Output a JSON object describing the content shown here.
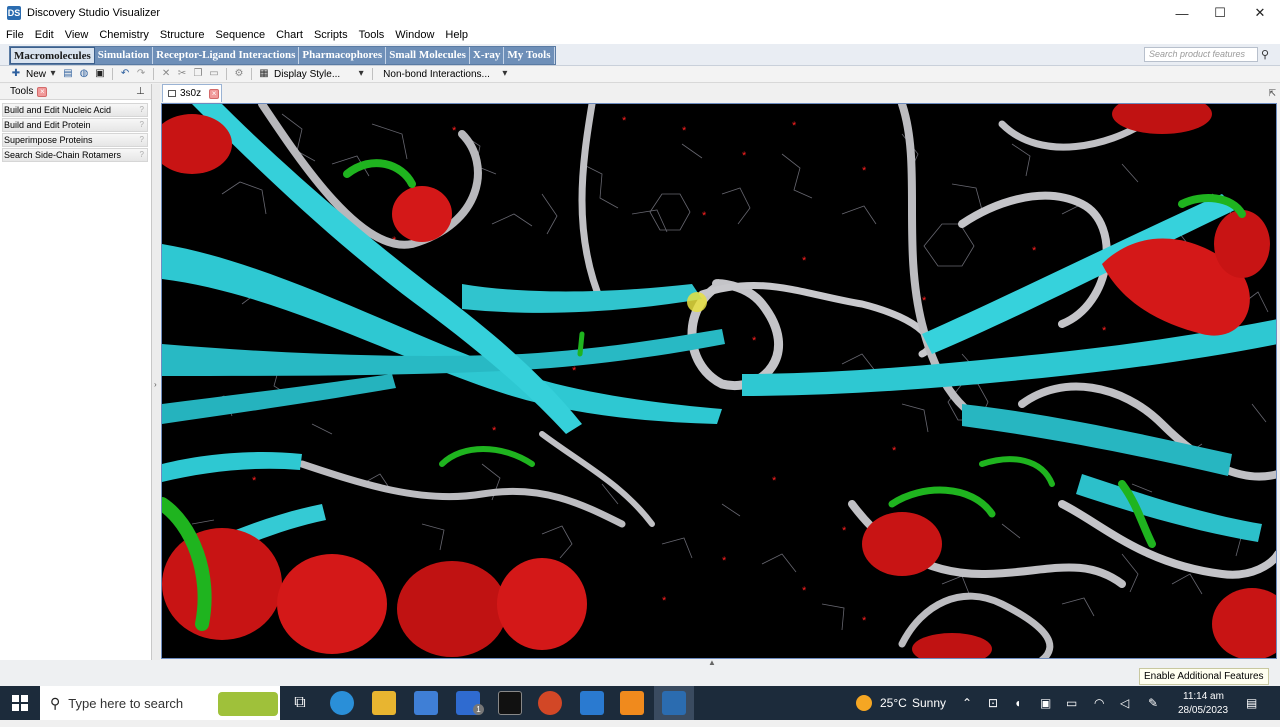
{
  "window": {
    "title": "Discovery Studio Visualizer",
    "minimize": "—",
    "maximize": "☐",
    "close": "✕"
  },
  "menu": [
    "File",
    "Edit",
    "View",
    "Chemistry",
    "Structure",
    "Sequence",
    "Chart",
    "Scripts",
    "Tools",
    "Window",
    "Help"
  ],
  "ribbon": {
    "tabs": [
      "Macromolecules",
      "Simulation",
      "Receptor-Ligand Interactions",
      "Pharmacophores",
      "Small Molecules",
      "X-ray",
      "My Tools"
    ],
    "active_tab": "Macromolecules",
    "search_placeholder": "Search product features"
  },
  "toolbar": {
    "new_label": "New",
    "display_style_label": "Display Style...",
    "nonbond_label": "Non-bond Interactions..."
  },
  "tools_panel": {
    "title": "Tools",
    "items": [
      "Build and Edit Nucleic Acid",
      "Build and Edit Protein",
      "Superimpose Proteins",
      "Search Side-Chain Rotamers"
    ]
  },
  "document": {
    "tab_label": "3s0z"
  },
  "statusbar": {
    "enable_label": "Enable Additional Features"
  },
  "taskbar": {
    "search_placeholder": "Type here to search",
    "weather_temp": "25°C",
    "weather_text": "Sunny",
    "time": "11:14 am",
    "date": "28/05/2023",
    "badge_count": "1"
  },
  "colors": {
    "sheet": "#2ec8d2",
    "helix": "#d41818",
    "turn": "#1fb41f",
    "coil": "#c8c8cc"
  }
}
